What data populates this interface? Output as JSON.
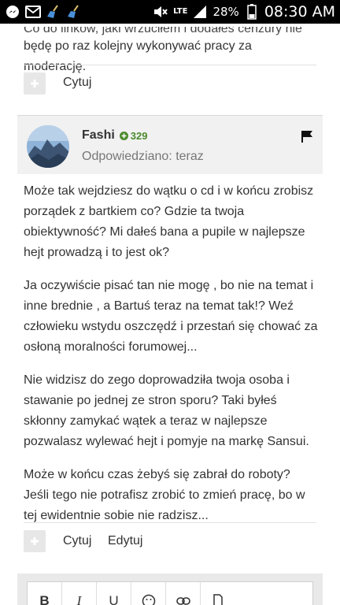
{
  "status_bar": {
    "network": "LTE",
    "battery": "28%",
    "time": "08:30 AM",
    "icons": [
      "messenger-icon",
      "gmail-icon",
      "broom-icon",
      "broom-icon",
      "mute-icon",
      "signal-icon",
      "battery-icon"
    ]
  },
  "prev_post": {
    "cut_text": "Co do linków, jaki wrzuciłem i dodałeś cenzury nie",
    "last_line": "będę po raz kolejny wykonywać pracy za moderację.",
    "quote_label": "Cytuj"
  },
  "post": {
    "author": "Fashi",
    "reputation": "329",
    "replied": "Odpowiedziano: teraz",
    "paragraphs": [
      "Może tak wejdziesz do wątku o cd i w końcu zrobisz porządek z bartkiem co? Gdzie ta twoja obiektywność?  Mi dałeś bana a pupile w najlepsze hejt prowadzą i to jest ok?",
      "Ja oczywiście pisać tan nie mogę , bo nie na temat i inne brednie , a Bartuś teraz na temat tak!? Weź człowieku wstydu oszczędź i przestań się chować za osłoną moralności forumowej...",
      "Nie widzisz do zego doprowadziła twoja osoba i stawanie po jednej ze stron  sporu? Taki byłeś skłonny zamykać wątek a teraz w najlepsze pozwalasz wylewać hejt i pomyje na markę Sansui.",
      "Może w końcu czas żebyś się zabrał do roboty?  Jeśli tego nie potrafisz zrobić to zmień pracę, bo w tej ewidentnie sobie nie radzisz..."
    ],
    "quote_label": "Cytuj",
    "edit_label": "Edytuj"
  },
  "editor": {
    "bold": "B",
    "italic": "I",
    "underline": "U"
  },
  "colors": {
    "reputation": "#4b8a2e",
    "header_bg": "#f1f1f1",
    "button_bg": "#e7e7e7"
  }
}
